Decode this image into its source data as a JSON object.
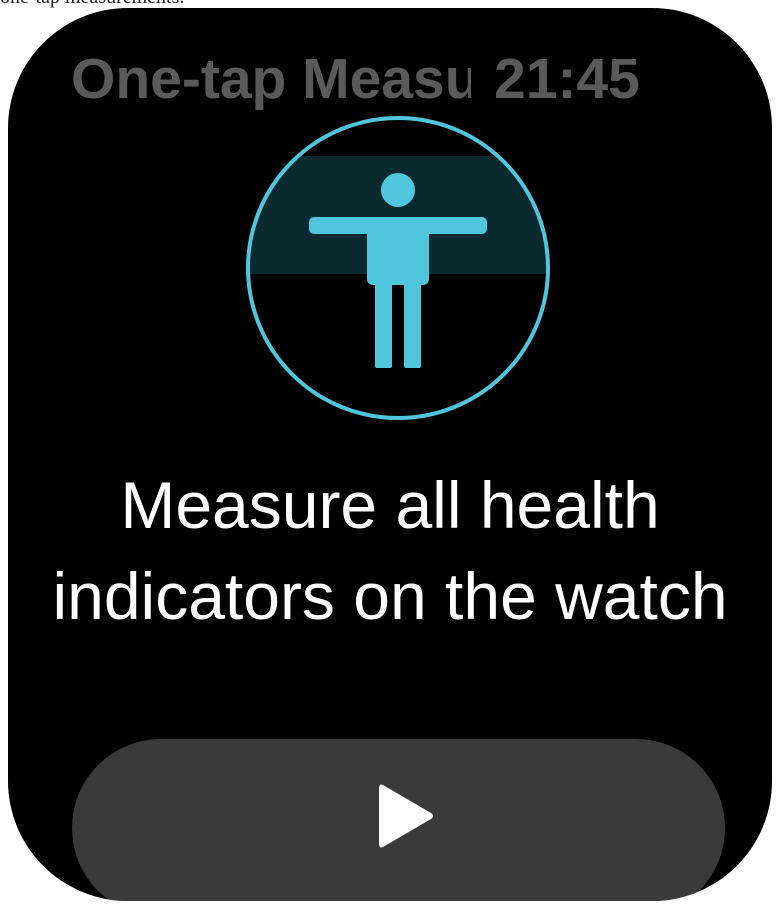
{
  "caption": "one-tap measurements.",
  "status_bar": {
    "app_title": "One-tap Measur",
    "time": "21:45"
  },
  "hero": {
    "icon": "body-scan-icon",
    "accent_color": "#4fc6dc",
    "ring_color": "#4fc6dc"
  },
  "main": {
    "headline": "Measure all health indicators on the watch"
  },
  "start_button": {
    "icon": "play-icon",
    "background": "#3a3a3a"
  }
}
